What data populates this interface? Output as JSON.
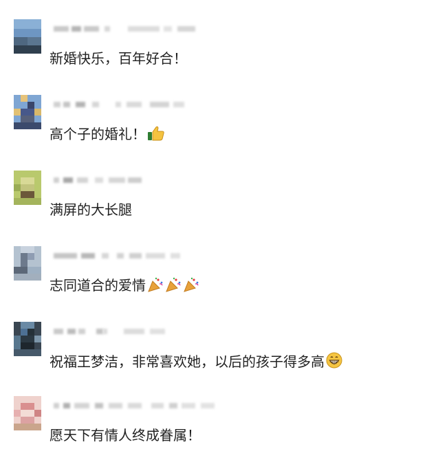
{
  "comments": [
    {
      "text": "新婚快乐，百年好合！",
      "avatar_colors": [
        "#7da5cf",
        "#5d86b4",
        "#3d5468",
        "#2c3c4a"
      ],
      "emoji": []
    },
    {
      "text": "高个子的婚礼！",
      "avatar_colors": [
        "#6f9ed2",
        "#e7c57a",
        "#3e4a6e",
        "#8aa4c7"
      ],
      "emoji": [
        "thumbs-up-icon"
      ]
    },
    {
      "text": "满屏的大长腿",
      "avatar_colors": [
        "#b7c86b",
        "#a8b560",
        "#6c5a3b",
        "#d1d38e"
      ],
      "emoji": []
    },
    {
      "text": "志同道合的爱情",
      "avatar_colors": [
        "#b7c2cf",
        "#8b9ab0",
        "#5e6a7c",
        "#a6b8c6"
      ],
      "emoji": [
        "party-popper-icon",
        "party-popper-icon",
        "party-popper-icon"
      ]
    },
    {
      "text": "祝福王梦洁，非常喜欢她，以后的孩子得多高",
      "avatar_colors": [
        "#4f6f8c",
        "#2c3640",
        "#5a7c95",
        "#1e262d"
      ],
      "emoji": [
        "grinning-face-icon"
      ]
    },
    {
      "text": "愿天下有情人终成眷属！",
      "avatar_colors": [
        "#e8b7b7",
        "#d78e8e",
        "#f2d7d0",
        "#caa58c"
      ],
      "emoji": []
    }
  ]
}
